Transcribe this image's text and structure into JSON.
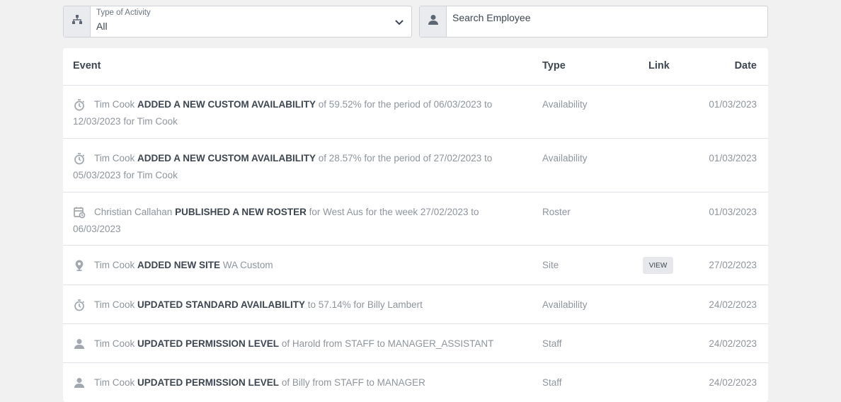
{
  "filters": {
    "activity": {
      "label": "Type of Activity",
      "value": "All",
      "icon": "sitemap-icon"
    },
    "employee": {
      "placeholder": "Search Employee",
      "icon": "user-icon"
    }
  },
  "table": {
    "headers": {
      "event": "Event",
      "type": "Type",
      "link": "Link",
      "date": "Date"
    },
    "rows": [
      {
        "icon": "stopwatch-icon",
        "actor": "Tim Cook",
        "action": "ADDED A NEW CUSTOM AVAILABILITY",
        "detail": "of 59.52% for the period of 06/03/2023 to 12/03/2023 for Tim Cook",
        "type": "Availability",
        "link": "",
        "date": "01/03/2023"
      },
      {
        "icon": "stopwatch-icon",
        "actor": "Tim Cook",
        "action": "ADDED A NEW CUSTOM AVAILABILITY",
        "detail": "of 28.57% for the period of 27/02/2023 to 05/03/2023 for Tim Cook",
        "type": "Availability",
        "link": "",
        "date": "01/03/2023"
      },
      {
        "icon": "calendar-clock-icon",
        "actor": "Christian Callahan",
        "action": "PUBLISHED A NEW ROSTER",
        "detail": "for West Aus for the week 27/02/2023 to 06/03/2023",
        "type": "Roster",
        "link": "",
        "date": "01/03/2023"
      },
      {
        "icon": "map-pin-icon",
        "actor": "Tim Cook",
        "action": "ADDED NEW SITE",
        "detail": "WA Custom",
        "type": "Site",
        "link": "VIEW",
        "date": "27/02/2023"
      },
      {
        "icon": "stopwatch-icon",
        "actor": "Tim Cook",
        "action": "UPDATED STANDARD AVAILABILITY",
        "detail": "to 57.14% for Billy Lambert",
        "type": "Availability",
        "link": "",
        "date": "24/02/2023"
      },
      {
        "icon": "user-icon",
        "actor": "Tim Cook",
        "action": "UPDATED PERMISSION LEVEL",
        "detail": "of Harold from STAFF to MANAGER_ASSISTANT",
        "type": "Staff",
        "link": "",
        "date": "24/02/2023"
      },
      {
        "icon": "user-icon",
        "actor": "Tim Cook",
        "action": "UPDATED PERMISSION LEVEL",
        "detail": "of Billy from STAFF to MANAGER",
        "type": "Staff",
        "link": "",
        "date": "24/02/2023"
      }
    ]
  }
}
